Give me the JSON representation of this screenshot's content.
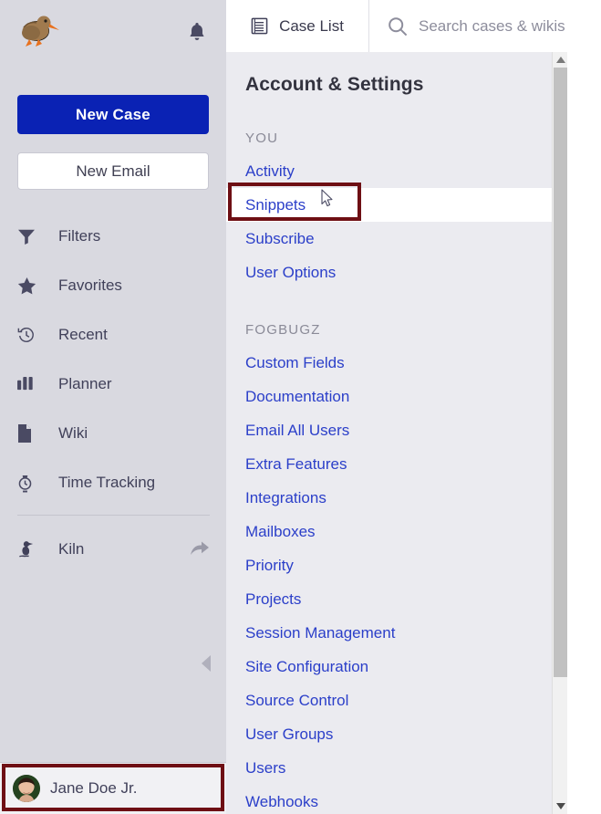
{
  "sidebar": {
    "logo_icon": "kiwi-bird-logo",
    "notifications_icon": "bell-icon",
    "new_case_label": "New Case",
    "new_email_label": "New Email",
    "nav_items": [
      {
        "label": "Filters",
        "icon": "filter-funnel-icon"
      },
      {
        "label": "Favorites",
        "icon": "star-icon"
      },
      {
        "label": "Recent",
        "icon": "clock-history-icon"
      },
      {
        "label": "Planner",
        "icon": "bar-chart-icon"
      },
      {
        "label": "Wiki",
        "icon": "page-document-icon"
      },
      {
        "label": "Time Tracking",
        "icon": "stopwatch-icon"
      }
    ],
    "kiln": {
      "label": "Kiln",
      "icon": "kiln-bird-icon",
      "external_icon": "external-link-arrow-icon"
    },
    "collapse_icon": "chevron-left-icon",
    "user": {
      "name": "Jane Doe Jr.",
      "avatar_icon": "user-avatar"
    }
  },
  "topbar": {
    "tab": {
      "label": "Case List",
      "icon": "case-list-icon"
    },
    "search": {
      "placeholder": "Search cases & wikis",
      "value": "",
      "icon": "search-icon"
    }
  },
  "content": {
    "page_title": "Account & Settings",
    "groups": [
      {
        "label": "YOU",
        "links": [
          {
            "label": "Activity",
            "hovered": false
          },
          {
            "label": "Snippets",
            "hovered": true
          },
          {
            "label": "Subscribe",
            "hovered": false
          },
          {
            "label": "User Options",
            "hovered": false
          }
        ]
      },
      {
        "label": "FOGBUGZ",
        "links": [
          {
            "label": "Custom Fields",
            "hovered": false
          },
          {
            "label": "Documentation",
            "hovered": false
          },
          {
            "label": "Email All Users",
            "hovered": false
          },
          {
            "label": "Extra Features",
            "hovered": false
          },
          {
            "label": "Integrations",
            "hovered": false
          },
          {
            "label": "Mailboxes",
            "hovered": false
          },
          {
            "label": "Priority",
            "hovered": false
          },
          {
            "label": "Projects",
            "hovered": false
          },
          {
            "label": "Session Management",
            "hovered": false
          },
          {
            "label": "Site Configuration",
            "hovered": false
          },
          {
            "label": "Source Control",
            "hovered": false
          },
          {
            "label": "User Groups",
            "hovered": false
          },
          {
            "label": "Users",
            "hovered": false
          },
          {
            "label": "Webhooks",
            "hovered": false
          }
        ]
      }
    ]
  },
  "scrollbar": {
    "up_icon": "scroll-up-arrow-icon",
    "down_icon": "scroll-down-arrow-icon",
    "thumb_icon": "scrollbar-thumb"
  },
  "annotations": {
    "highlight_color": "#6e0f14",
    "snippets_target": "Snippets",
    "user_target": "Jane Doe Jr.",
    "cursor_icon": "mouse-pointer-cursor"
  },
  "colors": {
    "accent_blue": "#0a22b4",
    "link_blue": "#2b3fc9",
    "sidebar_bg": "#d9d9e0",
    "content_bg": "#ebebf0",
    "text_dark": "#41415a",
    "annotation_red": "#6e0f14"
  }
}
